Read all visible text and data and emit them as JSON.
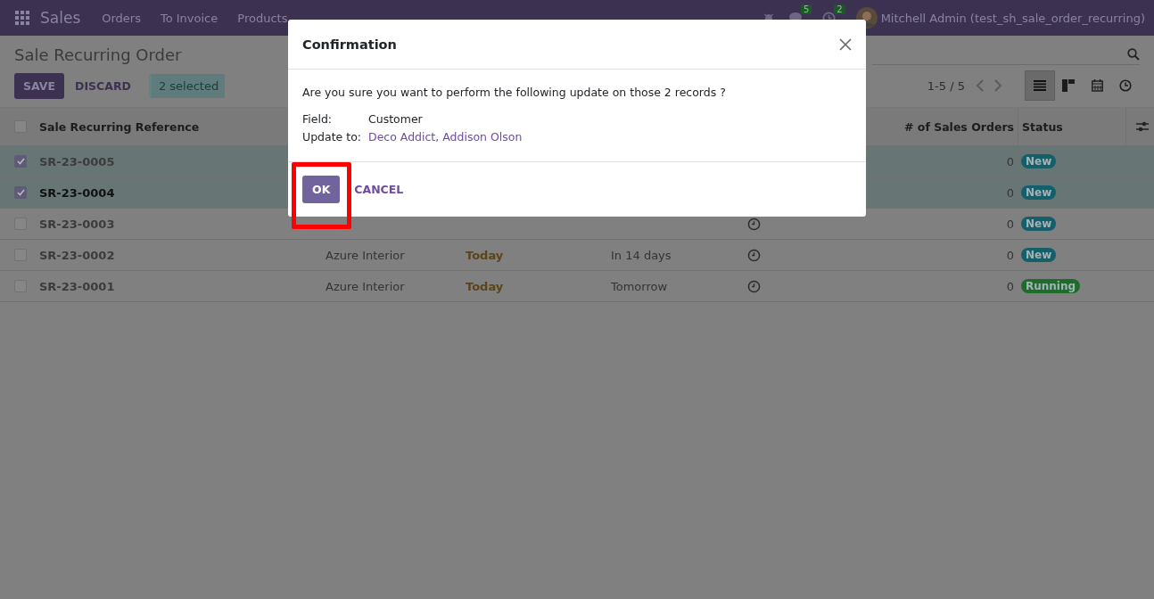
{
  "navbar": {
    "app_name": "Sales",
    "menu": [
      "Orders",
      "To Invoice",
      "Products"
    ],
    "messages_count": "5",
    "activities_count": "2",
    "user": "Mitchell Admin (test_sh_sale_order_recurring)"
  },
  "control_panel": {
    "title": "Sale Recurring Order",
    "buttons": [
      {
        "label": "SAVE",
        "kind": "primary"
      },
      {
        "label": "DISCARD",
        "kind": "secondary"
      }
    ],
    "selection": "2 selected",
    "pager": "1-5 / 5",
    "views": [
      {
        "kind": "list",
        "selected": true
      },
      {
        "kind": "kanban",
        "selected": false
      },
      {
        "kind": "calendar",
        "selected": false
      },
      {
        "kind": "activity",
        "selected": false
      }
    ]
  },
  "table": {
    "all_selected": false,
    "columns": [
      "Sale Recurring Reference",
      "# of Sales Orders",
      "Status"
    ],
    "rows": [
      {
        "selected": true,
        "editing": false,
        "reference": "SR-23-0005",
        "count": "0",
        "status": {
          "label": "New",
          "color": "#155f6b"
        }
      },
      {
        "selected": true,
        "editing": true,
        "reference": "SR-23-0004",
        "count": "0",
        "status": {
          "label": "New",
          "color": "#155f6b"
        }
      },
      {
        "selected": false,
        "editing": false,
        "reference": "SR-23-0003",
        "activity": true,
        "count": "0",
        "status": {
          "label": "New",
          "color": "#155f6b"
        }
      },
      {
        "selected": false,
        "editing": false,
        "reference": "SR-23-0002",
        "customer": "Azure Interior",
        "date": "Today",
        "next": "In 14 days",
        "activity": true,
        "count": "0",
        "status": {
          "label": "New",
          "color": "#155f6b"
        }
      },
      {
        "selected": false,
        "editing": false,
        "reference": "SR-23-0001",
        "customer": "Azure Interior",
        "date": "Today",
        "next": "Tomorrow",
        "activity": true,
        "count": "0",
        "status": {
          "label": "Running",
          "color": "#1f6b2c"
        }
      }
    ]
  },
  "dialog": {
    "title": "Confirmation",
    "message": "Are you sure you want to perform the following update on those 2 records ?",
    "fields": [
      {
        "label": "Field:",
        "value": "Customer",
        "kind": "text"
      },
      {
        "label": "Update to:",
        "value": "Deco Addict, Addison Olson",
        "kind": "link"
      }
    ],
    "buttons": [
      {
        "label": "OK",
        "kind": "primary",
        "highlighted": true
      },
      {
        "label": "CANCEL",
        "kind": "secondary",
        "highlighted": false
      }
    ]
  }
}
